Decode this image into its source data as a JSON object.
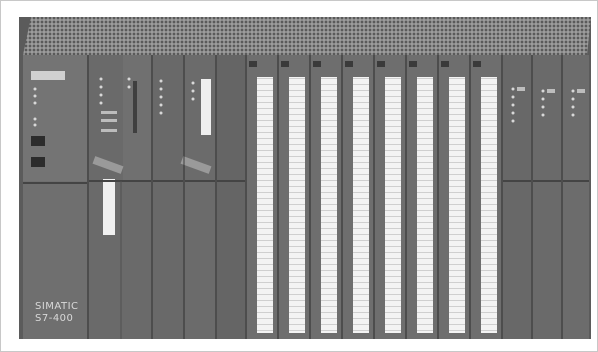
{
  "image": {
    "subject": "modular-plc-rack",
    "colors": {
      "background": "#ffffff",
      "module_body": "#6f6f6f",
      "module_dark": "#4a4a4a",
      "vent_top": "#8a8a8a",
      "label_strip": "#f2f2f2",
      "led": "#d8d8d8"
    },
    "modules": [
      {
        "kind": "power"
      },
      {
        "kind": "cpu"
      },
      {
        "kind": "communication"
      },
      {
        "kind": "communication"
      },
      {
        "kind": "blank"
      },
      {
        "kind": "io"
      },
      {
        "kind": "io"
      },
      {
        "kind": "io"
      },
      {
        "kind": "io"
      },
      {
        "kind": "io"
      },
      {
        "kind": "io"
      },
      {
        "kind": "io"
      },
      {
        "kind": "io"
      },
      {
        "kind": "interface"
      },
      {
        "kind": "interface"
      },
      {
        "kind": "interface"
      }
    ]
  },
  "rack_label": {
    "line1": "SIMATIC",
    "line2": "S7-400"
  }
}
